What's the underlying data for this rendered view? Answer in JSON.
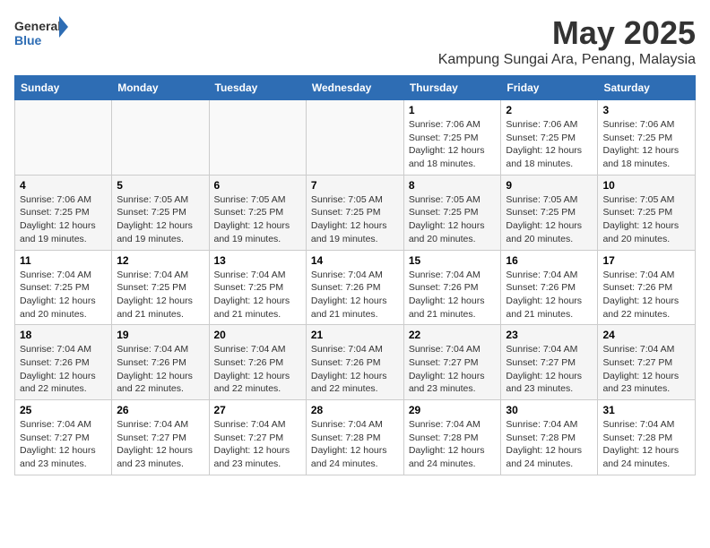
{
  "header": {
    "logo_general": "General",
    "logo_blue": "Blue",
    "month_title": "May 2025",
    "location": "Kampung Sungai Ara, Penang, Malaysia"
  },
  "days_of_week": [
    "Sunday",
    "Monday",
    "Tuesday",
    "Wednesday",
    "Thursday",
    "Friday",
    "Saturday"
  ],
  "weeks": [
    [
      {
        "day": "",
        "info": ""
      },
      {
        "day": "",
        "info": ""
      },
      {
        "day": "",
        "info": ""
      },
      {
        "day": "",
        "info": ""
      },
      {
        "day": "1",
        "info": "Sunrise: 7:06 AM\nSunset: 7:25 PM\nDaylight: 12 hours\nand 18 minutes."
      },
      {
        "day": "2",
        "info": "Sunrise: 7:06 AM\nSunset: 7:25 PM\nDaylight: 12 hours\nand 18 minutes."
      },
      {
        "day": "3",
        "info": "Sunrise: 7:06 AM\nSunset: 7:25 PM\nDaylight: 12 hours\nand 18 minutes."
      }
    ],
    [
      {
        "day": "4",
        "info": "Sunrise: 7:06 AM\nSunset: 7:25 PM\nDaylight: 12 hours\nand 19 minutes."
      },
      {
        "day": "5",
        "info": "Sunrise: 7:05 AM\nSunset: 7:25 PM\nDaylight: 12 hours\nand 19 minutes."
      },
      {
        "day": "6",
        "info": "Sunrise: 7:05 AM\nSunset: 7:25 PM\nDaylight: 12 hours\nand 19 minutes."
      },
      {
        "day": "7",
        "info": "Sunrise: 7:05 AM\nSunset: 7:25 PM\nDaylight: 12 hours\nand 19 minutes."
      },
      {
        "day": "8",
        "info": "Sunrise: 7:05 AM\nSunset: 7:25 PM\nDaylight: 12 hours\nand 20 minutes."
      },
      {
        "day": "9",
        "info": "Sunrise: 7:05 AM\nSunset: 7:25 PM\nDaylight: 12 hours\nand 20 minutes."
      },
      {
        "day": "10",
        "info": "Sunrise: 7:05 AM\nSunset: 7:25 PM\nDaylight: 12 hours\nand 20 minutes."
      }
    ],
    [
      {
        "day": "11",
        "info": "Sunrise: 7:04 AM\nSunset: 7:25 PM\nDaylight: 12 hours\nand 20 minutes."
      },
      {
        "day": "12",
        "info": "Sunrise: 7:04 AM\nSunset: 7:25 PM\nDaylight: 12 hours\nand 21 minutes."
      },
      {
        "day": "13",
        "info": "Sunrise: 7:04 AM\nSunset: 7:25 PM\nDaylight: 12 hours\nand 21 minutes."
      },
      {
        "day": "14",
        "info": "Sunrise: 7:04 AM\nSunset: 7:26 PM\nDaylight: 12 hours\nand 21 minutes."
      },
      {
        "day": "15",
        "info": "Sunrise: 7:04 AM\nSunset: 7:26 PM\nDaylight: 12 hours\nand 21 minutes."
      },
      {
        "day": "16",
        "info": "Sunrise: 7:04 AM\nSunset: 7:26 PM\nDaylight: 12 hours\nand 21 minutes."
      },
      {
        "day": "17",
        "info": "Sunrise: 7:04 AM\nSunset: 7:26 PM\nDaylight: 12 hours\nand 22 minutes."
      }
    ],
    [
      {
        "day": "18",
        "info": "Sunrise: 7:04 AM\nSunset: 7:26 PM\nDaylight: 12 hours\nand 22 minutes."
      },
      {
        "day": "19",
        "info": "Sunrise: 7:04 AM\nSunset: 7:26 PM\nDaylight: 12 hours\nand 22 minutes."
      },
      {
        "day": "20",
        "info": "Sunrise: 7:04 AM\nSunset: 7:26 PM\nDaylight: 12 hours\nand 22 minutes."
      },
      {
        "day": "21",
        "info": "Sunrise: 7:04 AM\nSunset: 7:26 PM\nDaylight: 12 hours\nand 22 minutes."
      },
      {
        "day": "22",
        "info": "Sunrise: 7:04 AM\nSunset: 7:27 PM\nDaylight: 12 hours\nand 23 minutes."
      },
      {
        "day": "23",
        "info": "Sunrise: 7:04 AM\nSunset: 7:27 PM\nDaylight: 12 hours\nand 23 minutes."
      },
      {
        "day": "24",
        "info": "Sunrise: 7:04 AM\nSunset: 7:27 PM\nDaylight: 12 hours\nand 23 minutes."
      }
    ],
    [
      {
        "day": "25",
        "info": "Sunrise: 7:04 AM\nSunset: 7:27 PM\nDaylight: 12 hours\nand 23 minutes."
      },
      {
        "day": "26",
        "info": "Sunrise: 7:04 AM\nSunset: 7:27 PM\nDaylight: 12 hours\nand 23 minutes."
      },
      {
        "day": "27",
        "info": "Sunrise: 7:04 AM\nSunset: 7:27 PM\nDaylight: 12 hours\nand 23 minutes."
      },
      {
        "day": "28",
        "info": "Sunrise: 7:04 AM\nSunset: 7:28 PM\nDaylight: 12 hours\nand 24 minutes."
      },
      {
        "day": "29",
        "info": "Sunrise: 7:04 AM\nSunset: 7:28 PM\nDaylight: 12 hours\nand 24 minutes."
      },
      {
        "day": "30",
        "info": "Sunrise: 7:04 AM\nSunset: 7:28 PM\nDaylight: 12 hours\nand 24 minutes."
      },
      {
        "day": "31",
        "info": "Sunrise: 7:04 AM\nSunset: 7:28 PM\nDaylight: 12 hours\nand 24 minutes."
      }
    ]
  ]
}
